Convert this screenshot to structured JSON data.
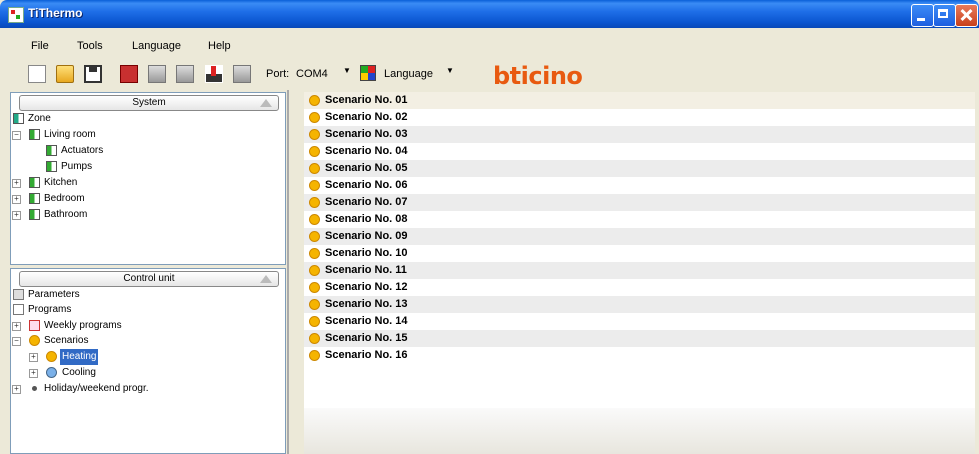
{
  "window": {
    "title": "TiThermo"
  },
  "menu": [
    "File",
    "Tools",
    "Language",
    "Help"
  ],
  "toolbar": {
    "port_label": "Port:",
    "port_value": "COM4",
    "language_label": "Language",
    "brand": "bticino",
    "brand_color": "#e85a10"
  },
  "system_panel": {
    "header": "System",
    "zone": "Zone",
    "rooms": [
      {
        "label": "Living room",
        "expanded": true,
        "children": [
          "Actuators",
          "Pumps"
        ]
      },
      {
        "label": "Kitchen",
        "expanded": false
      },
      {
        "label": "Bedroom",
        "expanded": false
      },
      {
        "label": "Bathroom",
        "expanded": false
      }
    ]
  },
  "control_panel": {
    "header": "Control unit",
    "parameters": "Parameters",
    "programs": "Programs",
    "weekly_programs": "Weekly programs",
    "scenarios": "Scenarios",
    "heating": "Heating",
    "cooling": "Cooling",
    "holiday": "Holiday/weekend progr.",
    "selected": "Heating"
  },
  "scenarios": [
    "Scenario No. 01",
    "Scenario No. 02",
    "Scenario No. 03",
    "Scenario No. 04",
    "Scenario No. 05",
    "Scenario No. 06",
    "Scenario No. 07",
    "Scenario No. 08",
    "Scenario No. 09",
    "Scenario No. 10",
    "Scenario No. 11",
    "Scenario No. 12",
    "Scenario No. 13",
    "Scenario No. 14",
    "Scenario No. 15",
    "Scenario No. 16"
  ]
}
